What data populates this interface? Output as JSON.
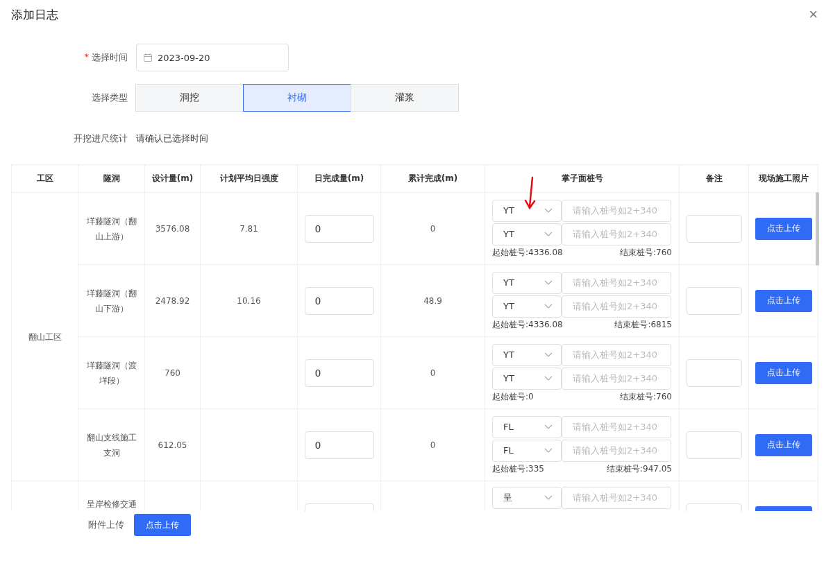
{
  "dialog": {
    "title": "添加日志",
    "close": "×"
  },
  "form": {
    "date": {
      "required_mark": "*",
      "label": "选择时间",
      "value": "2023-09-20"
    },
    "type": {
      "label": "选择类型",
      "options": [
        {
          "label": "洞挖",
          "selected": false
        },
        {
          "label": "衬砌",
          "selected": true
        },
        {
          "label": "灌浆",
          "selected": false
        }
      ]
    },
    "stats": {
      "label": "开挖进尺统计",
      "value": "请确认已选择时间"
    }
  },
  "table": {
    "columns": [
      "工区",
      "隧洞",
      "设计量(m)",
      "计划平均日强度",
      "日完成量(m)",
      "累计完成(m)",
      "掌子面桩号",
      "备注",
      "现场施工照片"
    ],
    "groups": [
      {
        "area": "翻山工区",
        "rows": [
          {
            "tunnel": "垟藤隧洞（翻山上游）",
            "design": "3576.08",
            "plan": "7.81",
            "daily": "0",
            "total": "0",
            "stakes": [
              {
                "prefix": "YT",
                "placeholder": "请输入桩号如2+340"
              },
              {
                "prefix": "YT",
                "placeholder": "请输入桩号如2+340"
              }
            ],
            "start": "起始桩号:4336.08",
            "end": "结束桩号:760",
            "upload": "点击上传"
          },
          {
            "tunnel": "垟藤隧洞（翻山下游）",
            "design": "2478.92",
            "plan": "10.16",
            "daily": "0",
            "total": "48.9",
            "stakes": [
              {
                "prefix": "YT",
                "placeholder": "请输入桩号如2+340"
              },
              {
                "prefix": "YT",
                "placeholder": "请输入桩号如2+340"
              }
            ],
            "start": "起始桩号:4336.08",
            "end": "结束桩号:6815",
            "upload": "点击上传"
          },
          {
            "tunnel": "垟藤隧洞（渡垟段）",
            "design": "760",
            "plan": "",
            "daily": "0",
            "total": "0",
            "stakes": [
              {
                "prefix": "YT",
                "placeholder": "请输入桩号如2+340"
              },
              {
                "prefix": "YT",
                "placeholder": "请输入桩号如2+340"
              }
            ],
            "start": "起始桩号:0",
            "end": "结束桩号:760",
            "upload": "点击上传"
          },
          {
            "tunnel": "翻山支线施工支洞",
            "design": "612.05",
            "plan": "",
            "daily": "0",
            "total": "0",
            "stakes": [
              {
                "prefix": "FL",
                "placeholder": "请输入桩号如2+340"
              },
              {
                "prefix": "FL",
                "placeholder": "请输入桩号如2+340"
              }
            ],
            "start": "起始桩号:335",
            "end": "结束桩号:947.05",
            "upload": "点击上传"
          }
        ]
      },
      {
        "partial": {
          "tunnel": "呈岸检修交通",
          "stake": {
            "prefix": "呈",
            "placeholder": "请输入桩号如2+340"
          }
        }
      }
    ]
  },
  "footer": {
    "label": "附件上传",
    "button": "点击上传"
  }
}
